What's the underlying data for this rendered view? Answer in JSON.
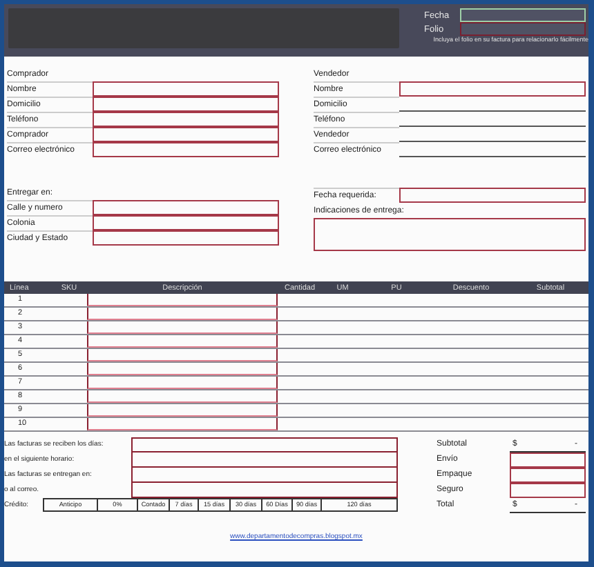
{
  "header": {
    "fields": [
      {
        "label": "Fecha"
      },
      {
        "label": "Folio"
      }
    ],
    "note": "Incluya el folio en su factura para relacionarlo fácilmente"
  },
  "buyer": {
    "title": "Comprador",
    "fields": [
      "Nombre",
      "Domicilio",
      "Teléfono",
      "Comprador",
      "Correo electrónico"
    ]
  },
  "seller": {
    "title": "Vendedor",
    "fields": [
      "Nombre",
      "Domicilio",
      "Teléfono",
      "Vendedor",
      "Correo electrónico"
    ]
  },
  "delivery": {
    "title": "Entregar en:",
    "fields": [
      "Calle y numero",
      "Colonia",
      "Ciudad y Estado"
    ]
  },
  "required_date": {
    "label": "Fecha requerida:"
  },
  "instructions": {
    "label": "Indicaciones de entrega:"
  },
  "table": {
    "columns": [
      "Línea",
      "SKU",
      "Descripción",
      "Cantidad",
      "UM",
      "PU",
      "Descuento",
      "Subtotal"
    ],
    "rows": [
      "1",
      "2",
      "3",
      "4",
      "5",
      "6",
      "7",
      "8",
      "9",
      "10"
    ]
  },
  "invoice_notes": [
    "Las facturas se reciben los días:",
    "en el siguiente horario:",
    "Las facturas se entregan en:",
    "o al correo."
  ],
  "credit": {
    "label": "Crédito:",
    "options": [
      "Anticipo",
      "0%",
      "Contado",
      "7 días",
      "15 días",
      "30 días",
      "60 Días",
      "90 días",
      "120 días"
    ]
  },
  "totals": [
    {
      "label": "Subtotal",
      "kind": "computed",
      "currency": "$",
      "value": "-"
    },
    {
      "label": "Envío",
      "kind": "input"
    },
    {
      "label": "Empaque",
      "kind": "input"
    },
    {
      "label": "Seguro",
      "kind": "input"
    },
    {
      "label": "Total",
      "kind": "computed",
      "currency": "$",
      "value": "-"
    }
  ],
  "footer_link": "www.departamentodecompras.blogspot.mx"
}
